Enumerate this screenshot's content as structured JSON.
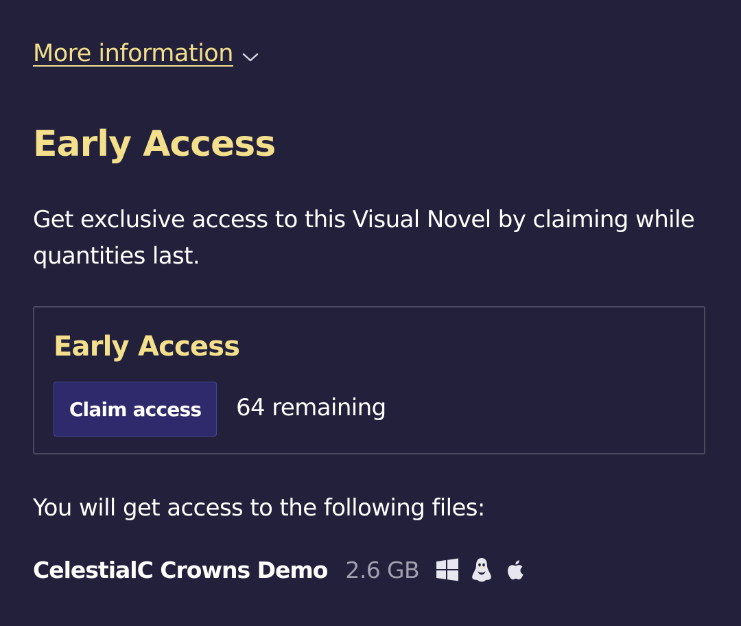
{
  "more_info": {
    "label": "More information",
    "icon": "chevron-down-icon"
  },
  "section": {
    "title": "Early Access",
    "description": "Get exclusive access to this Visual Novel by claiming while quantities last."
  },
  "reward": {
    "title": "Early Access",
    "claim_label": "Claim access",
    "remaining": "64 remaining"
  },
  "files": {
    "intro": "You will get access to the following files:",
    "items": [
      {
        "name": "CelestialC Crowns Demo",
        "size": "2.6 GB",
        "platforms": [
          "windows-icon",
          "linux-icon",
          "apple-icon"
        ]
      }
    ]
  },
  "colors": {
    "background": "#22203a",
    "accent": "#f3df8c",
    "button": "#2e2a6b",
    "muted": "#a19fb1",
    "border": "#4c4960"
  }
}
